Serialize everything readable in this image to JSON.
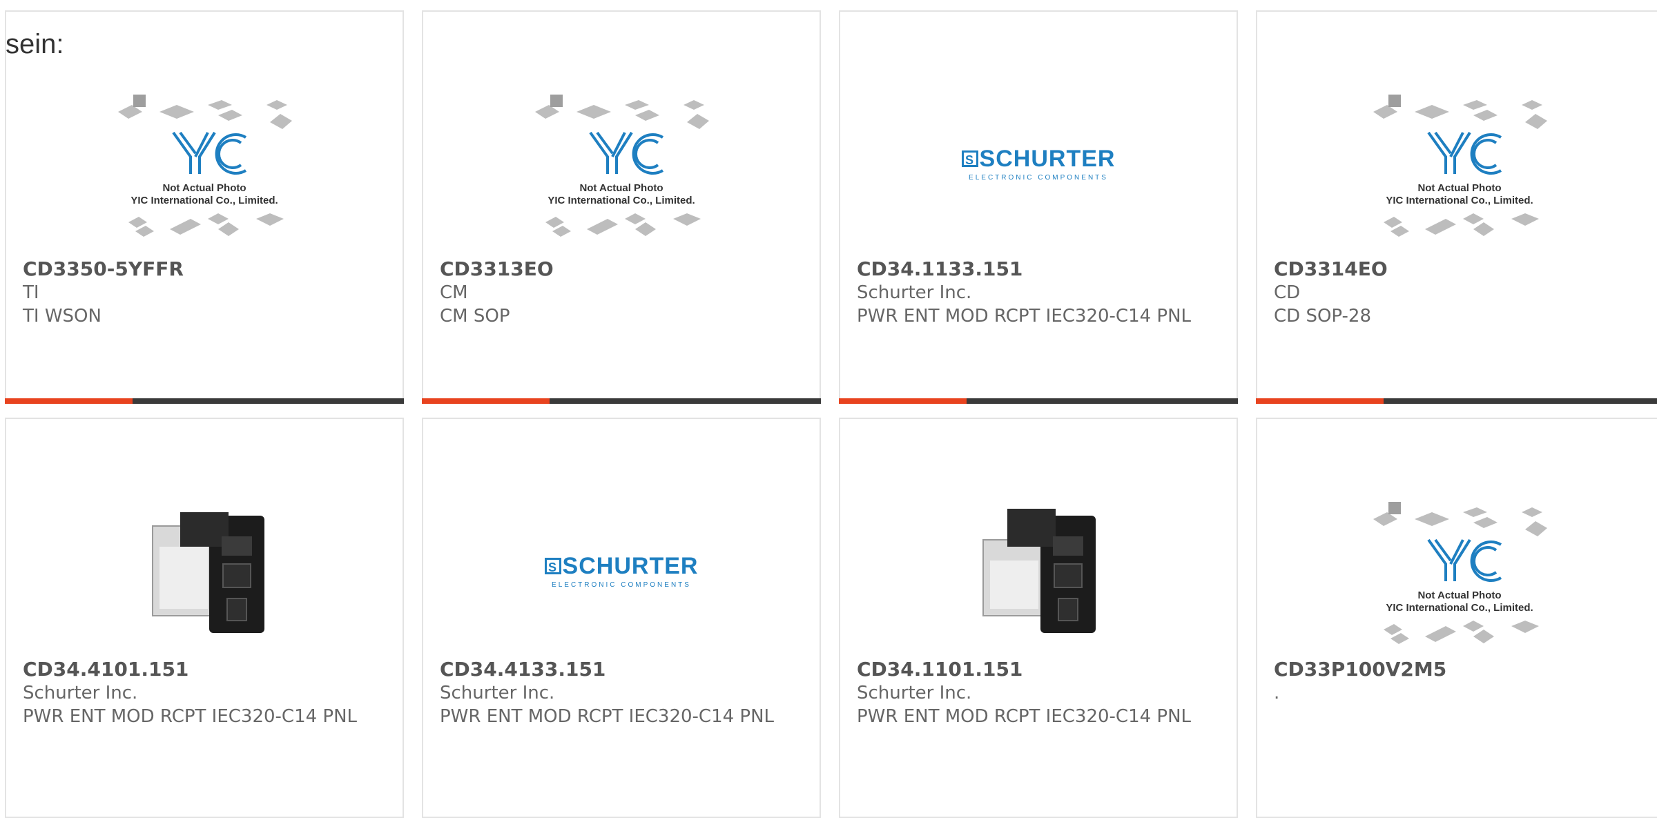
{
  "intro_text": "sein:",
  "placeholder": {
    "logo_text": "YIC",
    "caption_line1": "Not Actual Photo",
    "caption_line2": "YIC International Co., Limited."
  },
  "brand_logo": {
    "mark": "S",
    "word": "SCHURTER",
    "sub": "ELECTRONIC COMPONENTS"
  },
  "colors": {
    "accent": "#e8431f",
    "bar_dark": "#3a3a3a",
    "brand_blue": "#1e7fc1",
    "yic_blue": "#1e7fc1"
  },
  "products": [
    {
      "part": "CD3350-5YFFR",
      "mfr": "TI",
      "desc": "TI WSON",
      "image": "yic-placeholder"
    },
    {
      "part": "CD3313EO",
      "mfr": "CM",
      "desc": "CM SOP",
      "image": "yic-placeholder"
    },
    {
      "part": "CD34.1133.151",
      "mfr": "Schurter Inc.",
      "desc": "PWR ENT MOD RCPT IEC320-C14 PNL",
      "image": "schurter-logo"
    },
    {
      "part": "CD3314EO",
      "mfr": "CD",
      "desc": "CD SOP-28",
      "image": "yic-placeholder"
    },
    {
      "part": "CD34.4101.151",
      "mfr": "Schurter Inc.",
      "desc": "PWR ENT MOD RCPT IEC320-C14 PNL",
      "image": "power-entry-module-photo"
    },
    {
      "part": "CD34.4133.151",
      "mfr": "Schurter Inc.",
      "desc": "PWR ENT MOD RCPT IEC320-C14 PNL",
      "image": "schurter-logo"
    },
    {
      "part": "CD34.1101.151",
      "mfr": "Schurter Inc.",
      "desc": "PWR ENT MOD RCPT IEC320-C14 PNL",
      "image": "power-entry-module-photo"
    },
    {
      "part": "CD33P100V2M5",
      "mfr": ".",
      "desc": "",
      "image": "yic-placeholder"
    }
  ]
}
